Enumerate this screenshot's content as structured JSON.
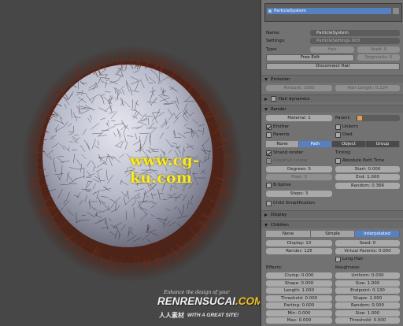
{
  "watermark": "www.cg-ku.com",
  "logo": {
    "tagline": "Enhance the design of your",
    "brand_a": "RENRENSUCAI",
    "brand_b": ".COM",
    "cn": "人人素材",
    "sub": "WITH A GREAT SITE!"
  },
  "list": {
    "item": "ParticleSystem"
  },
  "settings": {
    "name_label": "Name:",
    "name_value": "ParticleSystem",
    "settings_label": "Settings:",
    "settings_value": "ParticleSettings.003",
    "type_label": "Type:",
    "type_value": "Hair",
    "seed": "Seed: 0",
    "free_edit": "Free Edit",
    "segments": "Segments: 5",
    "disconnect": "Disconnect Hair"
  },
  "emission": {
    "title": "Emission",
    "amount": "Amount: 1000",
    "hair_length": "Hair Length: 0.224"
  },
  "hair_dynamics": {
    "title": "Hair dynamics"
  },
  "render": {
    "title": "Render",
    "material": "Material: 1",
    "parent_label": "Parent:",
    "emitter": "Emitter",
    "unborn": "Unborn",
    "parents": "Parents",
    "died": "Died",
    "modes": [
      "None",
      "Path",
      "Object",
      "Group"
    ],
    "strand_render": "Strand render",
    "timing": "Timing:",
    "adaptive": "Adaptive render",
    "abs_path_time": "Absolute Path Time",
    "degrees": "Degrees: 5",
    "start": "Start: 0.000",
    "pixel": "Pixel: 3",
    "end": "End: 1.000",
    "bspline": "B-Spline",
    "random": "Random: 0.366",
    "steps": "Steps: 3",
    "child_simpl": "Child Simplification"
  },
  "display": {
    "title": "Display"
  },
  "children": {
    "title": "Children",
    "modes": [
      "None",
      "Simple",
      "Interpolated"
    ],
    "display": "Display: 10",
    "seed": "Seed: 0",
    "render": "Render: 125",
    "virtual_parents": "Virtual Parents: 0.000",
    "long_hair": "Long Hair",
    "effects": "Effects:",
    "roughness": "Roughness:",
    "effects_fields": [
      "Clump: 0.000",
      "Shape: 0.000",
      "Length: 1.000",
      "Threshold: 0.000",
      "Parting: 0.000",
      "Min: 0.000",
      "Max: 0.000"
    ],
    "rough_fields": [
      "Uniform: 0.000",
      "Size: 1.000",
      "Endpoint: 0.130",
      "Shape: 1.000",
      "Random: 0.000",
      "Size: 1.000",
      "Threshold: 0.000"
    ]
  },
  "colors": {
    "accent": "#5680c2",
    "panel": "#727272",
    "viewport": "#474747"
  }
}
